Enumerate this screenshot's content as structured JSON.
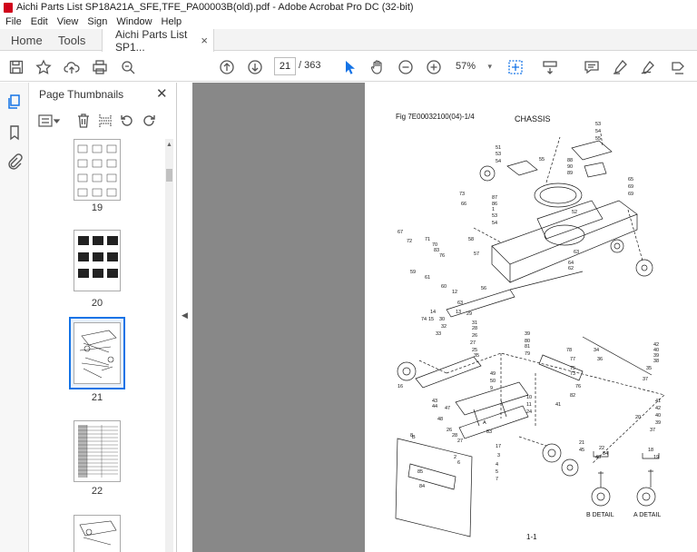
{
  "window": {
    "title": "Aichi Parts List SP18A21A_SFE,TFE_PA00003B(old).pdf - Adobe Acrobat Pro DC (32-bit)"
  },
  "menu": [
    "File",
    "Edit",
    "View",
    "Sign",
    "Window",
    "Help"
  ],
  "tabs": {
    "home": "Home",
    "tools": "Tools",
    "document": "Aichi Parts List SP1...",
    "close": "×"
  },
  "toolbar": {
    "current_page": "21",
    "page_of": "/  363",
    "zoom": "57%",
    "zoom_caret": "▾",
    "icons": [
      "save-icon",
      "bookmark-star-icon",
      "upload-cloud-icon",
      "print-icon",
      "zoom-search-icon",
      "page-up-icon",
      "page-down-icon",
      "select-cursor-icon",
      "hand-tool-icon",
      "zoom-out-icon",
      "zoom-in-icon",
      "fit-page-icon",
      "scroll-mode-icon",
      "comment-icon",
      "highlight-pen-icon",
      "sign-icon",
      "share-icon"
    ]
  },
  "sidebar": {
    "title": "Page Thumbnails",
    "close": "✕",
    "thumbnails": [
      {
        "label": "19",
        "selected": false
      },
      {
        "label": "20",
        "selected": false
      },
      {
        "label": "21",
        "selected": true
      },
      {
        "label": "22",
        "selected": false
      },
      {
        "label": "",
        "selected": false
      }
    ]
  },
  "document": {
    "fig_label": "Fig  7E00032100(04)-1/4",
    "title": "CHASSIS",
    "page_number": "1-1",
    "detail_b": "B   DETAIL",
    "detail_a": "A   DETAIL",
    "callouts": [
      "53",
      "54",
      "55",
      "51",
      "53",
      "54",
      "55",
      "88",
      "90",
      "89",
      "87",
      "86",
      "1",
      "53",
      "54",
      "52",
      "65",
      "69",
      "69",
      "66",
      "67",
      "73",
      "72",
      "71",
      "70",
      "83",
      "76",
      "58",
      "57",
      "63",
      "64",
      "62",
      "59",
      "61",
      "60",
      "56",
      "63",
      "12",
      "13",
      "74",
      "14",
      "15",
      "30",
      "32",
      "33",
      "31",
      "28",
      "26",
      "27",
      "25",
      "29",
      "35",
      "39",
      "80",
      "81",
      "79",
      "78",
      "77",
      "75",
      "73",
      "76",
      "82",
      "41",
      "42",
      "40",
      "39",
      "38",
      "35",
      "34",
      "37",
      "36",
      "41",
      "42",
      "40",
      "39",
      "37",
      "20",
      "22",
      "84",
      "83",
      "16",
      "17",
      "18",
      "19",
      "21",
      "45",
      "46",
      "43",
      "44",
      "48",
      "47",
      "49",
      "50",
      "9",
      "10",
      "11",
      "24",
      "26",
      "28",
      "27",
      "3",
      "4",
      "5",
      "7",
      "8",
      "2",
      "6",
      "85",
      "84",
      "A",
      "B"
    ]
  }
}
